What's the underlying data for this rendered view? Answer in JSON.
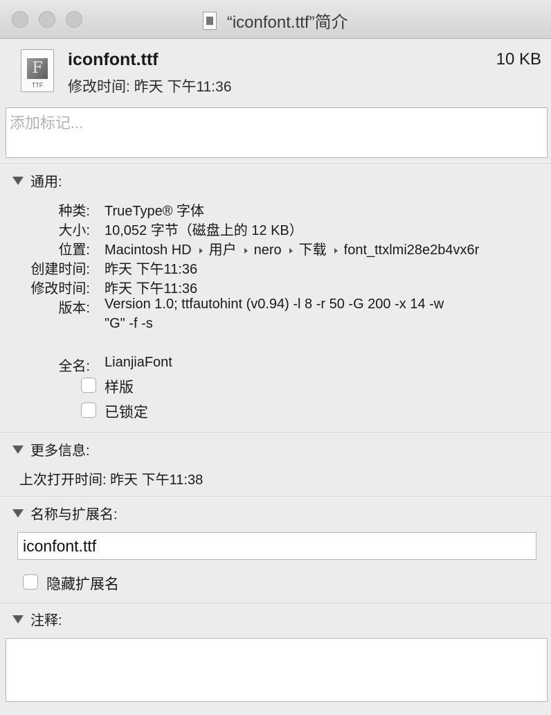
{
  "window": {
    "title": "“iconfont.ttf”简介"
  },
  "header": {
    "file_icon_label": "TTF",
    "file_name": "iconfont.ttf",
    "file_size": "10 KB",
    "modified": "修改时间: 昨天 下午11:36"
  },
  "tags": {
    "placeholder": "添加标记..."
  },
  "general": {
    "title": "通用:",
    "kind_label": "种类:",
    "kind_value": "TrueType® 字体",
    "size_label": "大小:",
    "size_value": "10,052 字节（磁盘上的 12 KB）",
    "where_label": "位置:",
    "where_path": [
      "Macintosh HD",
      "用户",
      "nero",
      "下载",
      "font_ttxlmi28e2b4vx6r"
    ],
    "created_label": "创建时间:",
    "created_value": "昨天 下午11:36",
    "modified_label": "修改时间:",
    "modified_value": "昨天 下午11:36",
    "version_label": "版本:",
    "version_line1": "Version 1.0; ttfautohint (v0.94) -l 8 -r 50 -G 200 -x 14 -w",
    "version_line2": "\"G\" -f -s",
    "fullname_label": "全名:",
    "fullname_value": "LianjiaFont",
    "stationery_label": "样版",
    "stationery_checked": false,
    "locked_label": "已锁定",
    "locked_checked": false
  },
  "more_info": {
    "title": "更多信息:",
    "last_opened": "上次打开时间: 昨天 下午11:38"
  },
  "name_ext": {
    "title": "名称与扩展名:",
    "value": "iconfont.ttf",
    "hide_ext_label": "隐藏扩展名",
    "hide_ext_checked": false
  },
  "comments": {
    "title": "注释:"
  }
}
